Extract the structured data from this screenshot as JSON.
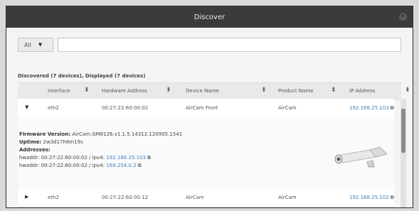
{
  "window": {
    "title": "Discover"
  },
  "filter": {
    "select_value": "All"
  },
  "summary": "Discovered (7 devices), Displayed (7 devices)",
  "columns": [
    "Interface",
    "Hardware Address",
    "Device Name",
    "Product Name",
    "IP Address"
  ],
  "rows": [
    {
      "interface": "eth2",
      "hw": "00:27:22:60:00:02",
      "name": "AirCam Front",
      "product": "AirCam",
      "ip": "192.168.25.103",
      "expanded": true
    },
    {
      "interface": "eth2",
      "hw": "00:27:22:60:00:12",
      "name": "AirCam",
      "product": "AirCam",
      "ip": "192.168.25.102",
      "expanded": false
    }
  ],
  "details": {
    "firmware_label": "Firmware Version:",
    "firmware_value": "AirCam.GM8126.v1.1.5.14312.120905.1541",
    "uptime_label": "Uptime:",
    "uptime_value": "2w3d17h8m19s",
    "addresses_label": "Addresses:",
    "addr1_prefix": "hwaddr: 00:27:22:60:00:02 / ipv4:",
    "addr1_ip": "192.168.25.103",
    "addr2_prefix": "hwaddr: 00:27:22:60:00:02 / ipv4:",
    "addr2_ip": "169.254.0.2"
  },
  "icons": {
    "close": "close-icon",
    "sort": "sort-icon",
    "external_link": "external-link-icon",
    "expand": "chevron-icon"
  },
  "colors": {
    "titlebar": "#3b3b3b",
    "link": "#3b7fc4"
  }
}
